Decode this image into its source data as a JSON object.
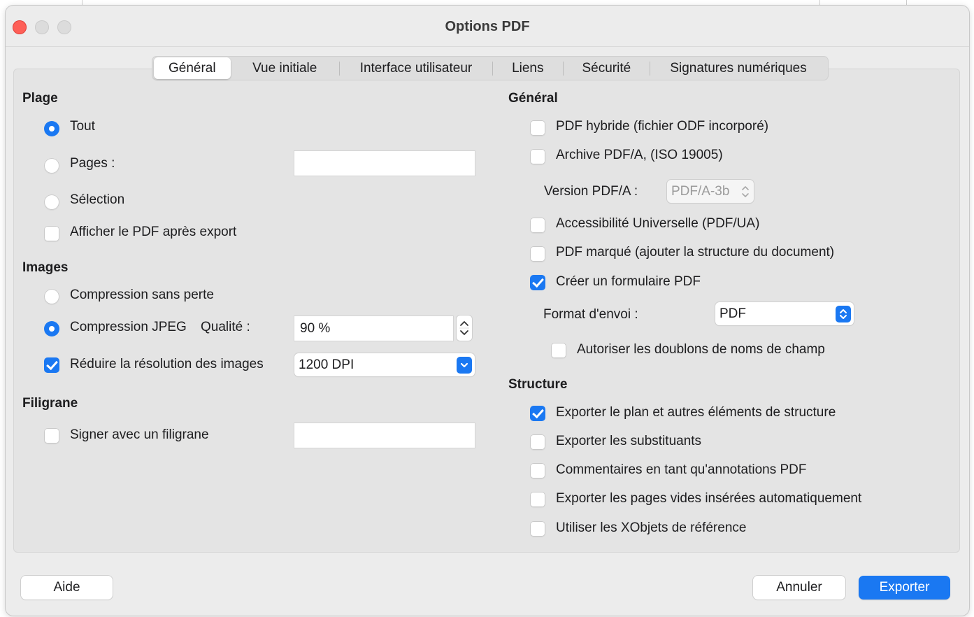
{
  "window": {
    "title": "Options PDF"
  },
  "tabs": [
    {
      "label": "Général",
      "active": true
    },
    {
      "label": "Vue initiale"
    },
    {
      "label": "Interface utilisateur"
    },
    {
      "label": "Liens"
    },
    {
      "label": "Sécurité"
    },
    {
      "label": "Signatures numériques"
    }
  ],
  "left": {
    "range": {
      "heading": "Plage",
      "all": "Tout",
      "pages": "Pages :",
      "pages_value": "",
      "selection": "Sélection",
      "view_after": "Afficher le PDF après export"
    },
    "images": {
      "heading": "Images",
      "lossless": "Compression sans perte",
      "jpeg": "Compression JPEG",
      "quality_label": "Qualité :",
      "quality_value": "90 %",
      "reduce": "Réduire la résolution des images",
      "dpi_value": "1200 DPI"
    },
    "watermark": {
      "heading": "Filigrane",
      "sign": "Signer avec un filigrane",
      "value": ""
    }
  },
  "right": {
    "general": {
      "heading": "Général",
      "hybrid": "PDF hybride (fichier ODF incorporé)",
      "archive": "Archive PDF/A, (ISO 19005)",
      "version_label": "Version PDF/A :",
      "version_value": "PDF/A-3b",
      "ua": "Accessibilité Universelle (PDF/UA)",
      "tagged": "PDF marqué (ajouter la structure du document)",
      "form": "Créer un formulaire PDF",
      "submit_label": "Format d'envoi :",
      "submit_value": "PDF",
      "duplicates": "Autoriser les doublons de noms de champ"
    },
    "structure": {
      "heading": "Structure",
      "outline": "Exporter le plan et autres éléments de structure",
      "placeholders": "Exporter les substituants",
      "comments": "Commentaires en tant qu'annotations PDF",
      "blank_pages": "Exporter les pages vides insérées automatiquement",
      "xobjects": "Utiliser les XObjets de référence"
    }
  },
  "buttons": {
    "help": "Aide",
    "cancel": "Annuler",
    "export": "Exporter"
  },
  "colors": {
    "accent": "#1a78f2",
    "close": "#fe5f57"
  }
}
